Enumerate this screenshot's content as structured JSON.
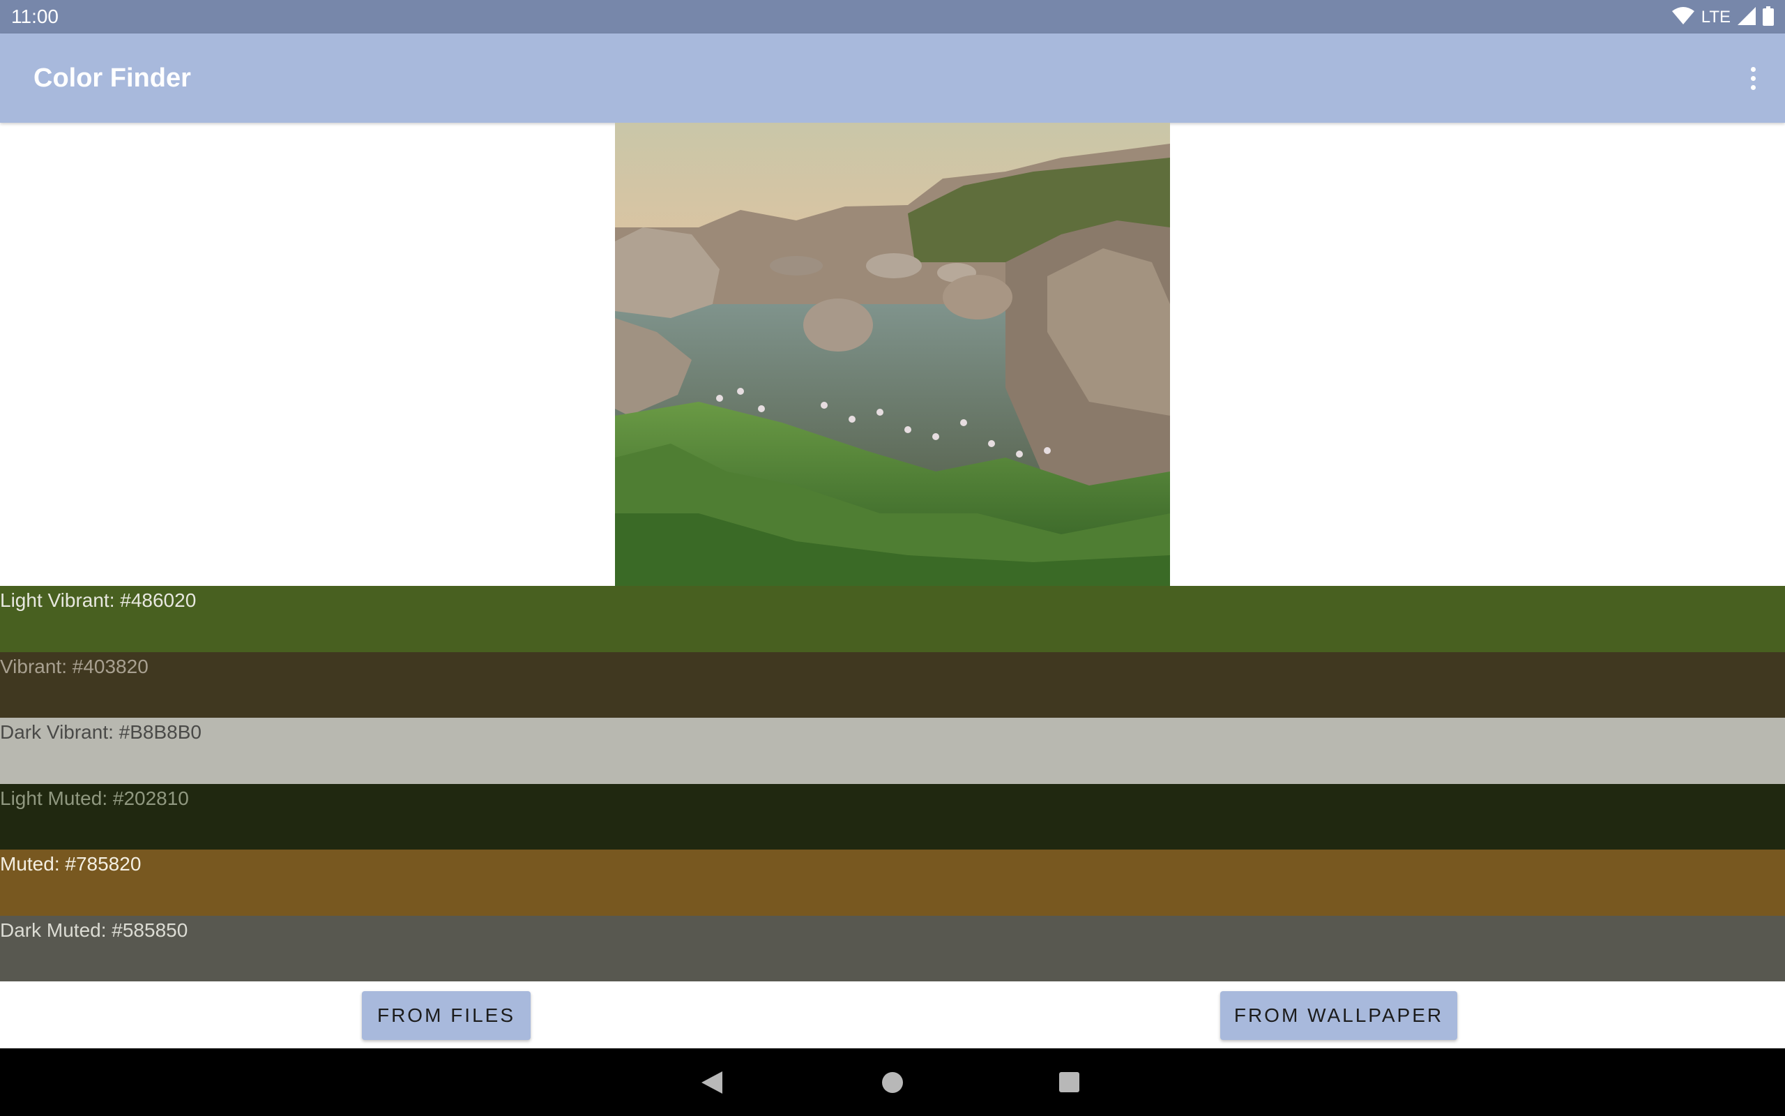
{
  "status_bar": {
    "time": "11:00",
    "network": "LTE",
    "icons": [
      "wifi-icon",
      "cell-signal-icon",
      "battery-icon"
    ]
  },
  "app_bar": {
    "title": "Color Finder",
    "menu_icon": "overflow-menu-icon"
  },
  "image": {
    "description_icon": "landscape-photo"
  },
  "palette": [
    {
      "label": "Light Vibrant: #486020",
      "bg": "#486020",
      "text_color": "#e8e8e0"
    },
    {
      "label": "Vibrant: #403820",
      "bg": "#403820",
      "text_color": "#a8a090"
    },
    {
      "label": "Dark Vibrant: #B8B8B0",
      "bg": "#b8b8b0",
      "text_color": "#4a4a48"
    },
    {
      "label": "Light Muted: #202810",
      "bg": "#202810",
      "text_color": "#909880"
    },
    {
      "label": "Muted: #785820",
      "bg": "#785820",
      "text_color": "#f4efe2"
    },
    {
      "label": "Dark Muted: #585850",
      "bg": "#585850",
      "text_color": "#dcdcd4"
    }
  ],
  "buttons": {
    "from_files": "FROM FILES",
    "from_wallpaper": "FROM WALLPAPER"
  },
  "nav_bar": {
    "icons": [
      "back-icon",
      "home-icon",
      "recents-icon"
    ]
  }
}
